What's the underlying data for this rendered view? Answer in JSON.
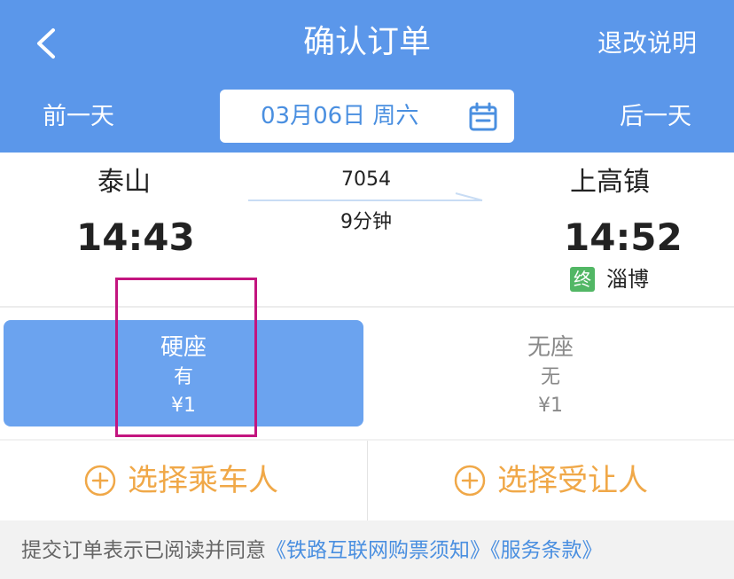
{
  "header": {
    "title": "确认订单",
    "refund_link": "退改说明",
    "prev_day": "前一天",
    "next_day": "后一天",
    "date": "03月06日 周六"
  },
  "trip": {
    "from_station": "泰山",
    "from_time": "14:43",
    "train_no": "7054",
    "duration": "9分钟",
    "to_station": "上高镇",
    "to_time": "14:52",
    "terminal_badge": "终",
    "terminal_city": "淄博"
  },
  "seats": [
    {
      "name": "硬座",
      "availability": "有",
      "price": "¥1",
      "selected": true
    },
    {
      "name": "无座",
      "availability": "无",
      "price": "¥1",
      "selected": false
    }
  ],
  "passengers": {
    "select_passenger": "选择乘车人",
    "select_beneficiary": "选择受让人"
  },
  "footer": {
    "notice": "提交订单表示已阅读并同意",
    "link1": "《铁路互联网购票须知》",
    "link2": "《服务条款》"
  },
  "colors": {
    "header_bg": "#5b97ea",
    "selected_seat_bg": "#6ba3ef",
    "accent_orange": "#f0a848",
    "link_blue": "#4a8fe0",
    "terminal_green": "#52b765",
    "highlight_magenta": "#c3157f"
  },
  "icons": {
    "back": "chevron-left-icon",
    "calendar": "calendar-icon",
    "add": "plus-circle-icon"
  }
}
